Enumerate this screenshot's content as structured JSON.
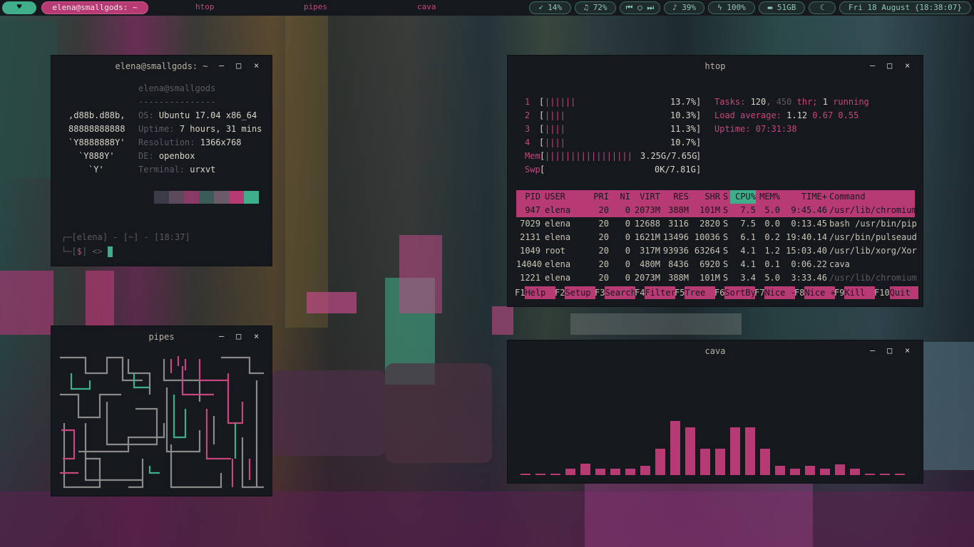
{
  "topbar": {
    "menu_icon": "heart-icon",
    "user_host": "elena@smallgods: ~",
    "workspaces": [
      "htop",
      "pipes",
      "cava"
    ],
    "status": [
      {
        "icon": "rocket-icon",
        "glyph": "➶",
        "label": "14%"
      },
      {
        "icon": "music-icon",
        "glyph": "♫",
        "label": "72%"
      },
      {
        "icon": "media-controls-icon",
        "glyph": "⏮ ○ ⏭",
        "label": ""
      },
      {
        "icon": "bell-icon",
        "glyph": "♪",
        "label": "39%"
      },
      {
        "icon": "battery-bolt-icon",
        "glyph": "ϟ",
        "label": "100%"
      },
      {
        "icon": "folder-icon",
        "glyph": "▬",
        "label": "51GB"
      },
      {
        "icon": "moon-icon",
        "glyph": "☾",
        "label": ""
      }
    ],
    "datetime": "Fri 18 August {18:38:07}"
  },
  "colors": {
    "accent_pink": "#b83a74",
    "accent_teal": "#3fae8b",
    "bg": "#15181d"
  },
  "term": {
    "title": "elena@smallgods: ~",
    "ascii": [
      ",d88b.d88b,",
      "88888888888",
      "`Y8888888Y'",
      "`Y888Y'",
      "`Y'"
    ],
    "host": "elena@smallgods",
    "separator": "---------------",
    "info": [
      {
        "key": "OS:",
        "value": "Ubuntu 17.04 x86_64"
      },
      {
        "key": "Uptime:",
        "value": "7 hours, 31 mins"
      },
      {
        "key": "Resolution:",
        "value": "1366x768"
      },
      {
        "key": "DE:",
        "value": "openbox"
      },
      {
        "key": "Terminal:",
        "value": "urxvt"
      }
    ],
    "palette": [
      "#3a3a48",
      "#5b4a5a",
      "#8a3a66",
      "#3b5c56",
      "#6a5a68",
      "#b83a74",
      "#3fae8b"
    ],
    "prompt1": {
      "pre": "┌─[",
      "user": "elena",
      "mid": "] - [",
      "path": "~",
      "mid2": "] - [",
      "time": "18:37",
      "end": "]"
    },
    "prompt2": {
      "pre": "└─[",
      "sym": "$",
      "end": "] <>"
    }
  },
  "pipes": {
    "title": "pipes"
  },
  "htop": {
    "title": "htop",
    "cpus": [
      {
        "n": "1",
        "bar": "||||||",
        "pct": "13.7%"
      },
      {
        "n": "2",
        "bar": "||||",
        "pct": "10.3%"
      },
      {
        "n": "3",
        "bar": "||||",
        "pct": "11.3%"
      },
      {
        "n": "4",
        "bar": "||||",
        "pct": "10.7%"
      }
    ],
    "mem": {
      "label": "Mem",
      "bar": "|||||||||||||||||",
      "value": "3.25G/7.65G"
    },
    "swp": {
      "label": "Swp",
      "value": "0K/7.81G"
    },
    "tasks": {
      "label": "Tasks:",
      "count": "120",
      "thr": "450",
      "thr_label": "thr;",
      "running": "1",
      "running_label": "running"
    },
    "load": {
      "label": "Load average:",
      "v1": "1.12",
      "v2": "0.67",
      "v3": "0.55"
    },
    "uptime": {
      "label": "Uptime:",
      "value": "07:31:38"
    },
    "headers": [
      "PID",
      "USER",
      "PRI",
      "NI",
      "VIRT",
      "RES",
      "SHR",
      "S",
      "CPU%",
      "MEM%",
      "TIME+",
      "Command"
    ],
    "rows": [
      [
        "947",
        "elena",
        "20",
        "0",
        "2073M",
        "388M",
        "101M",
        "S",
        "7.5",
        "5.0",
        "9:45.46",
        "/usr/lib/chromium"
      ],
      [
        "7029",
        "elena",
        "20",
        "0",
        "12688",
        "3116",
        "2820",
        "S",
        "7.5",
        "0.0",
        "0:13.45",
        "bash /usr/bin/pip"
      ],
      [
        "2131",
        "elena",
        "20",
        "0",
        "1621M",
        "13496",
        "10036",
        "S",
        "6.1",
        "0.2",
        "19:40.14",
        "/usr/bin/pulseaud"
      ],
      [
        "1049",
        "root",
        "20",
        "0",
        "317M",
        "93936",
        "63264",
        "S",
        "4.1",
        "1.2",
        "15:03.40",
        "/usr/lib/xorg/Xor"
      ],
      [
        "14040",
        "elena",
        "20",
        "0",
        "480M",
        "8436",
        "6920",
        "S",
        "4.1",
        "0.1",
        "0:06.22",
        "cava"
      ],
      [
        "1221",
        "elena",
        "20",
        "0",
        "2073M",
        "388M",
        "101M",
        "S",
        "3.4",
        "5.0",
        "3:33.46",
        "/usr/lib/chromium"
      ]
    ],
    "fkeys": [
      {
        "k": "F1",
        "l": "Help"
      },
      {
        "k": "F2",
        "l": "Setup"
      },
      {
        "k": "F3",
        "l": "Search"
      },
      {
        "k": "F4",
        "l": "Filter"
      },
      {
        "k": "F5",
        "l": "Tree"
      },
      {
        "k": "F6",
        "l": "SortBy"
      },
      {
        "k": "F7",
        "l": "Nice -"
      },
      {
        "k": "F8",
        "l": "Nice +"
      },
      {
        "k": "F9",
        "l": "Kill"
      },
      {
        "k": "F10",
        "l": "Quit"
      }
    ]
  },
  "cava": {
    "title": "cava",
    "levels": [
      0.02,
      0.02,
      0.02,
      0.08,
      0.15,
      0.08,
      0.08,
      0.08,
      0.12,
      0.34,
      0.7,
      0.62,
      0.34,
      0.34,
      0.62,
      0.62,
      0.34,
      0.12,
      0.08,
      0.12,
      0.08,
      0.14,
      0.08,
      0.02,
      0.02,
      0.02
    ]
  },
  "window_controls": {
    "minimize": "–",
    "maximize": "□",
    "close": "×"
  }
}
